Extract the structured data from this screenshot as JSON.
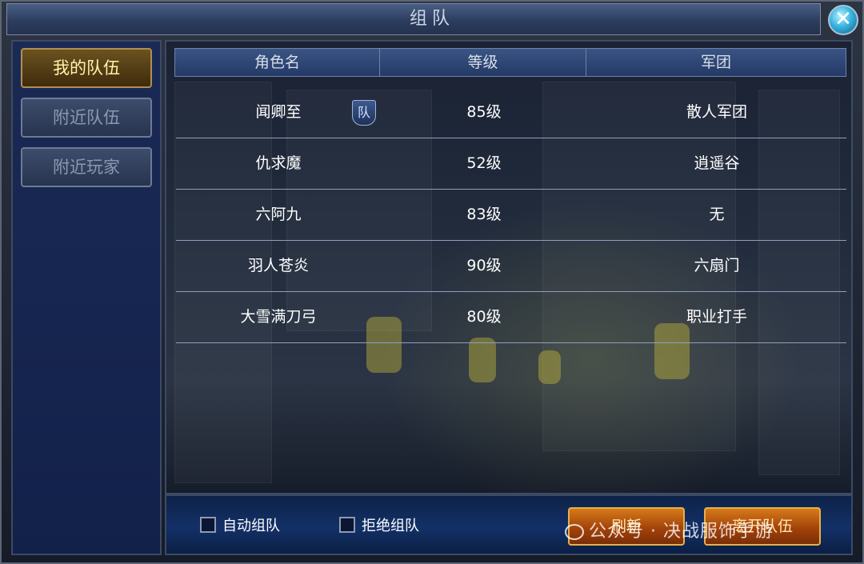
{
  "window": {
    "title": "组队",
    "close_icon": "close-x-icon"
  },
  "sidebar": {
    "items": [
      {
        "label": "我的队伍",
        "active": true
      },
      {
        "label": "附近队伍",
        "active": false
      },
      {
        "label": "附近玩家",
        "active": false
      }
    ]
  },
  "table": {
    "headers": [
      "角色名",
      "等级",
      "军团"
    ],
    "rows": [
      {
        "name": "闻卿至",
        "level": "85级",
        "guild": "散人军团",
        "badge": "队"
      },
      {
        "name": "仇求魔",
        "level": "52级",
        "guild": "逍遥谷"
      },
      {
        "name": "六阿九",
        "level": "83级",
        "guild": "无"
      },
      {
        "name": "羽人苍炎",
        "level": "90级",
        "guild": "六扇门"
      },
      {
        "name": "大雪满刀弓",
        "level": "80级",
        "guild": "职业打手"
      }
    ]
  },
  "footer": {
    "auto_team_label": "自动组队",
    "refuse_team_label": "拒绝组队",
    "refresh_label": "刷新",
    "leave_label": "离开队伍"
  },
  "watermark": "公众号 · 决战服饰手游",
  "colors": {
    "accent_gold": "#e6b04b",
    "active_tab_text": "#fff3a6",
    "header_blue": "#3a5484"
  }
}
